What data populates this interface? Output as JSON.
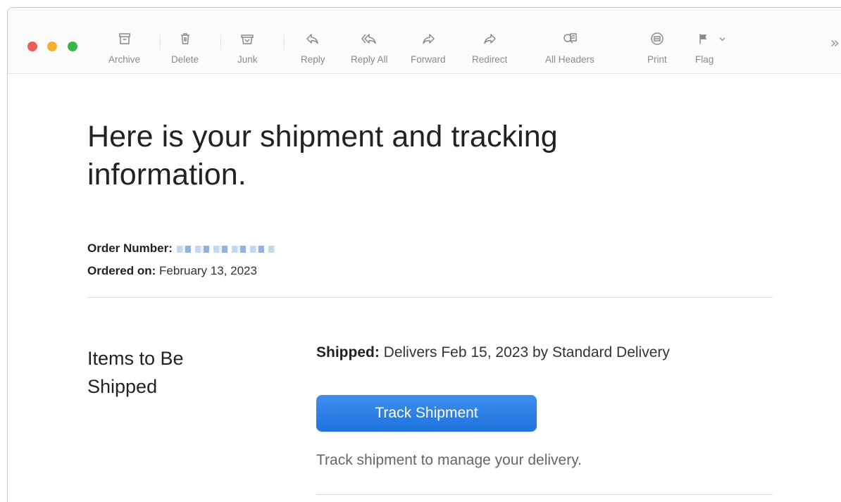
{
  "toolbar": {
    "archive": "Archive",
    "delete": "Delete",
    "junk": "Junk",
    "reply": "Reply",
    "reply_all": "Reply All",
    "forward": "Forward",
    "redirect": "Redirect",
    "all_headers": "All Headers",
    "print": "Print",
    "flag": "Flag",
    "overflow": "»"
  },
  "email": {
    "headline": "Here is your shipment and tracking information.",
    "order_number_label": "Order Number:",
    "ordered_on_label": "Ordered on:",
    "ordered_on_value": "February 13, 2023",
    "section_title": "Items to Be Shipped",
    "shipped_label": "Shipped:",
    "shipped_value": "Delivers Feb 15, 2023 by Standard Delivery",
    "track_button": "Track Shipment",
    "track_note": "Track shipment to manage your delivery."
  },
  "colors": {
    "close": "#ee5d55",
    "minimize": "#f3b02f",
    "zoom": "#39b54a",
    "accent": "#2a7fe6"
  }
}
